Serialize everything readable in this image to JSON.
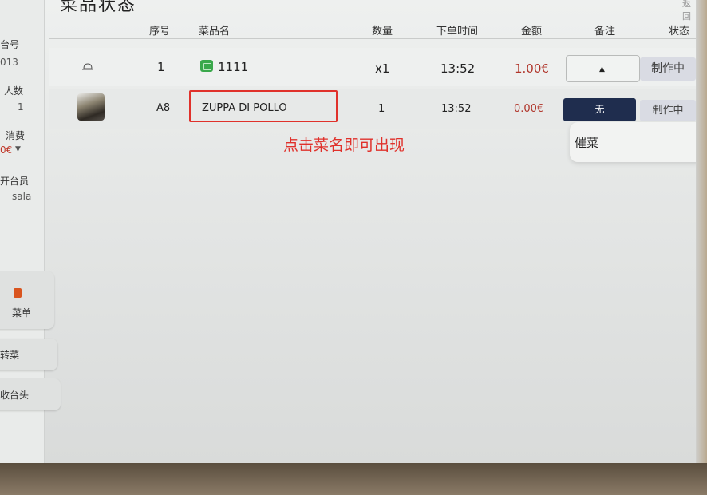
{
  "header": {
    "title": "菜品状态",
    "top_right": "返回"
  },
  "sidebar": {
    "table_label": "台号",
    "table_value": "013",
    "people_label": "人数",
    "people_value": "1",
    "spend_label": "消费",
    "spend_value": "0€",
    "staff_label": "开台员",
    "staff_value": "sala",
    "menu_label": "菜单",
    "transfer_label": "转菜",
    "collect_label": "收台头"
  },
  "columns": {
    "seq": "序号",
    "name": "菜品名",
    "qty": "数量",
    "time": "下单时间",
    "amount": "金额",
    "note": "备注",
    "status": "状态"
  },
  "rows": [
    {
      "seq": "1",
      "name": "1111",
      "qty": "x1",
      "time": "13:52",
      "amount": "1.00€",
      "status": "制作中"
    },
    {
      "seq": "A8",
      "name": "ZUPPA DI POLLO",
      "qty": "1",
      "time": "13:52",
      "amount": "0.00€",
      "note": "无",
      "status": "制作中"
    }
  ],
  "dropdown": {
    "option": "催菜"
  },
  "annotation": "点击菜名即可出现",
  "colors": {
    "accent_red": "#e0312b",
    "price_red": "#b0352a",
    "note_dark": "#1f2d4e",
    "dish_green": "#3aa84b"
  },
  "icons": {
    "row1": "bell-icon",
    "menu": "menu-icon",
    "spend_toggle": "chevron-down-icon"
  }
}
